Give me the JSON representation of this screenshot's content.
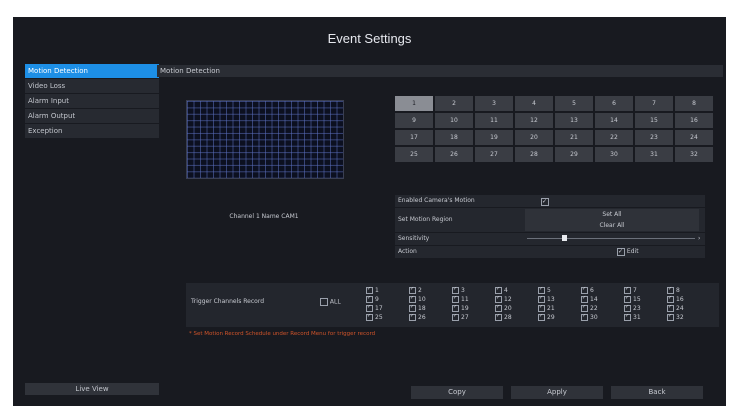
{
  "window": {
    "title": "Event Settings"
  },
  "sidebar": {
    "items": [
      {
        "label": "Motion Detection",
        "active": true
      },
      {
        "label": "Video Loss",
        "active": false
      },
      {
        "label": "Alarm Input",
        "active": false
      },
      {
        "label": "Alarm Output",
        "active": false
      },
      {
        "label": "Exception",
        "active": false
      }
    ],
    "live_view_label": "Live View"
  },
  "section": {
    "title": "Motion Detection"
  },
  "preview": {
    "channel_name": "Channel 1 Name CAM1"
  },
  "channels": {
    "selected": 1,
    "items": [
      "1",
      "2",
      "3",
      "4",
      "5",
      "6",
      "7",
      "8",
      "9",
      "10",
      "11",
      "12",
      "13",
      "14",
      "15",
      "16",
      "17",
      "18",
      "19",
      "20",
      "21",
      "22",
      "23",
      "24",
      "25",
      "26",
      "27",
      "28",
      "29",
      "30",
      "31",
      "32"
    ]
  },
  "settings": {
    "enable_label": "Enabled Camera's Motion",
    "enable_checked": true,
    "region_label": "Set Motion Region",
    "set_all_label": "Set All",
    "clear_all_label": "Clear All",
    "sensitivity_label": "Sensitivity",
    "sensitivity_value": 0.22,
    "action_label": "Action",
    "action_value": "Edit"
  },
  "trigger": {
    "label": "Trigger Channels Record",
    "all_label": "ALL",
    "all_checked": false,
    "channels": [
      "1",
      "2",
      "3",
      "4",
      "5",
      "6",
      "7",
      "8",
      "9",
      "10",
      "11",
      "12",
      "13",
      "14",
      "15",
      "16",
      "17",
      "18",
      "19",
      "20",
      "21",
      "22",
      "23",
      "24",
      "25",
      "26",
      "27",
      "28",
      "29",
      "30",
      "31",
      "32"
    ]
  },
  "note": "* Set Motion Record Schedule under Record Menu for trigger record",
  "buttons": {
    "copy": "Copy",
    "apply": "Apply",
    "back": "Back"
  },
  "colors": {
    "accent": "#1d8fe6",
    "background": "#181a20",
    "note": "#d0542a"
  }
}
